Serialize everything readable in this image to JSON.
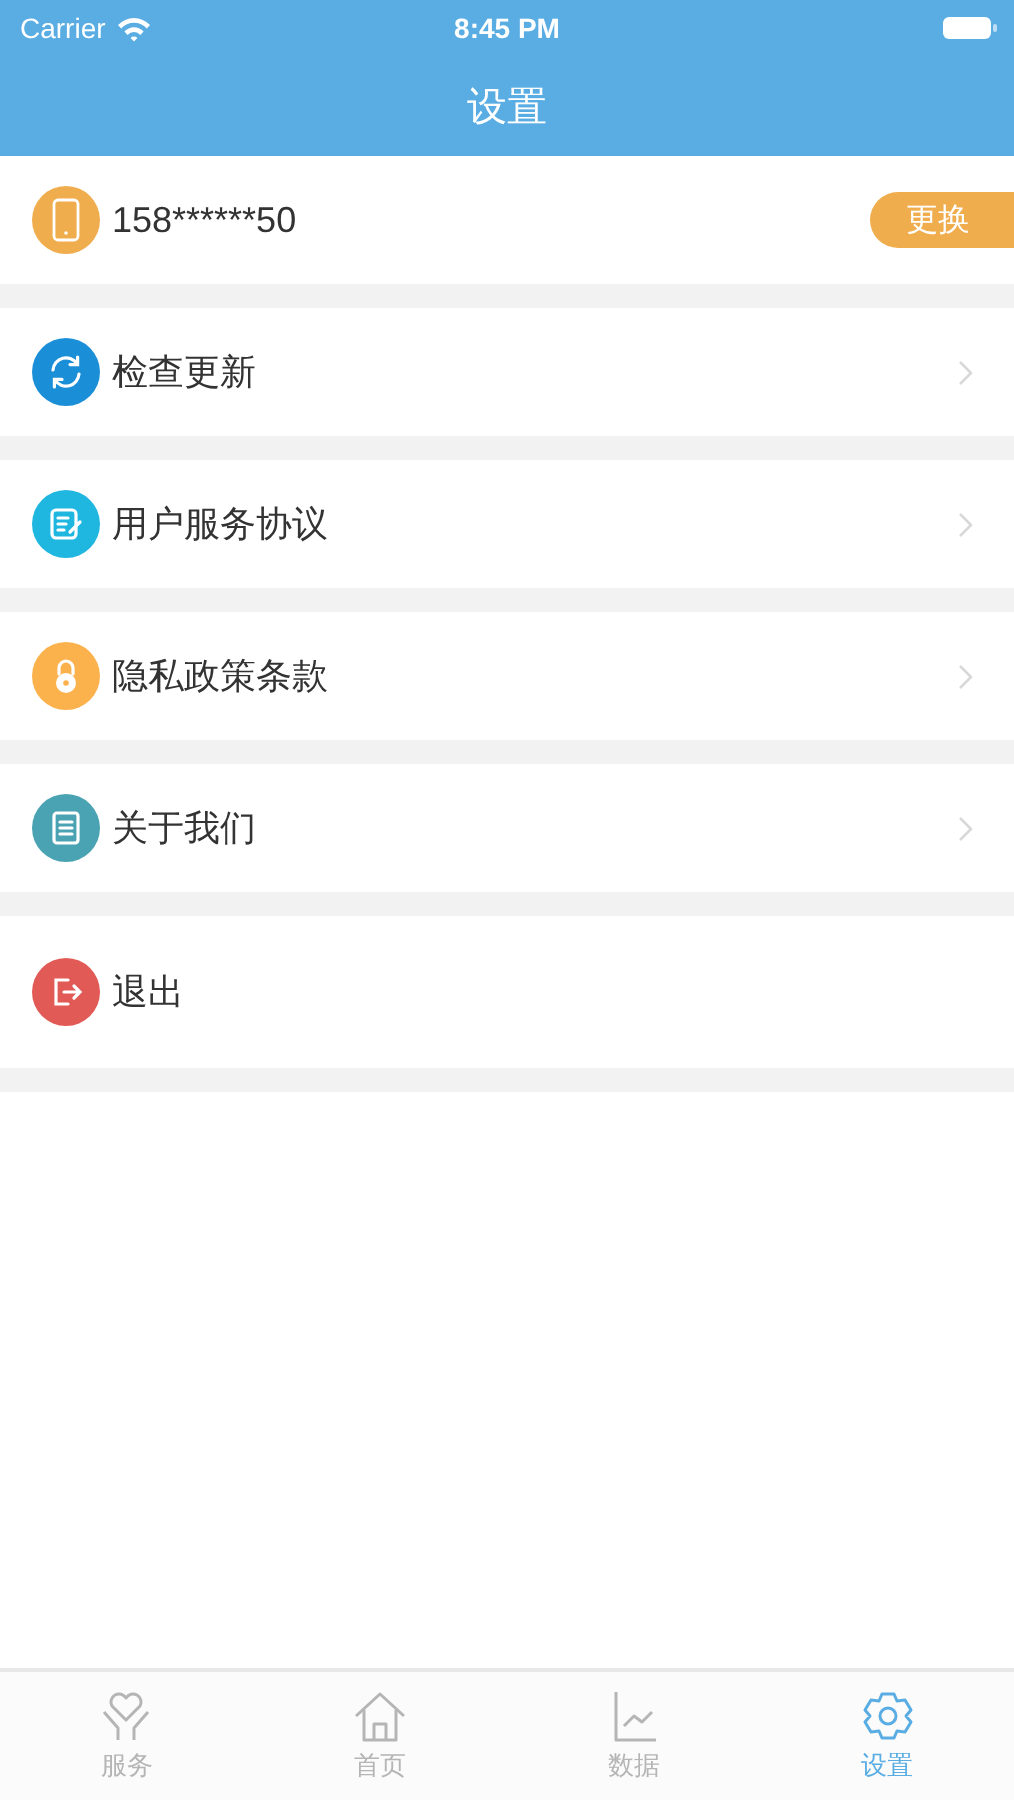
{
  "status_bar": {
    "carrier": "Carrier",
    "time": "8:45 PM"
  },
  "nav": {
    "title": "设置"
  },
  "account": {
    "phone": "158******50",
    "button": "更换"
  },
  "menu": [
    {
      "label": "检查更新",
      "kind": "refresh",
      "color": "#1a8fd8",
      "chevron": true
    },
    {
      "label": "用户服务协议",
      "kind": "document",
      "color": "#1fb6e0",
      "chevron": true
    },
    {
      "label": "隐私政策条款",
      "kind": "lock",
      "color": "#fbb24c",
      "chevron": true
    },
    {
      "label": "关于我们",
      "kind": "book",
      "color": "#4aa3b3",
      "chevron": true
    },
    {
      "label": "退出",
      "kind": "logout",
      "color": "#e25a56",
      "chevron": false
    }
  ],
  "tabs": [
    {
      "label": "服务",
      "kind": "heart",
      "selected": false
    },
    {
      "label": "首页",
      "kind": "home",
      "selected": false
    },
    {
      "label": "数据",
      "kind": "chart",
      "selected": false
    },
    {
      "label": "设置",
      "kind": "gear",
      "selected": true
    }
  ]
}
